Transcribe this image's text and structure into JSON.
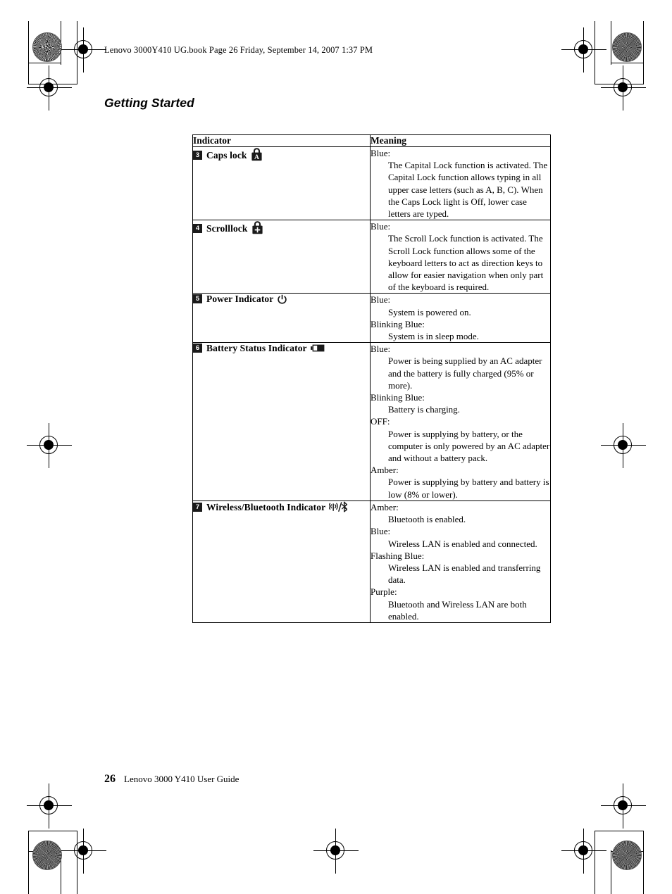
{
  "document": {
    "header_line": "Lenovo 3000Y410 UG.book  Page 26  Friday, September 14, 2007  1:37 PM",
    "page_title": "Getting Started",
    "footer": {
      "page_number": "26",
      "guide_title": "Lenovo 3000 Y410 User Guide"
    }
  },
  "table": {
    "headers": {
      "indicator": "Indicator",
      "meaning": "Meaning"
    },
    "rows": [
      {
        "number": "3",
        "label": "Caps lock",
        "icon": "caps-lock-padlock-icon",
        "meaning": [
          {
            "term": "Blue:",
            "desc": "The Capital Lock function is activated. The Capital Lock function allows typing in all upper case letters (such as A, B, C). When the Caps Lock light is Off, lower case letters are typed."
          }
        ]
      },
      {
        "number": "4",
        "label": "Scrolllock",
        "icon": "scroll-lock-padlock-icon",
        "meaning": [
          {
            "term": "Blue:",
            "desc": "The Scroll Lock function is activated. The Scroll Lock function allows some of the keyboard letters to act as direction keys to allow for easier navigation when only part of the keyboard is required."
          }
        ]
      },
      {
        "number": "5",
        "label": "Power Indicator",
        "icon": "power-icon",
        "meaning": [
          {
            "term": "Blue:",
            "desc": "System is powered on."
          },
          {
            "term": "Blinking Blue:",
            "desc": "System is in sleep mode."
          }
        ]
      },
      {
        "number": "6",
        "label": "Battery Status Indicator",
        "icon": "battery-icon",
        "meaning": [
          {
            "term": "Blue:",
            "desc": "Power is being supplied by an AC adapter and the battery is fully charged (95% or more)."
          },
          {
            "term": "Blinking Blue:",
            "desc": "Battery is charging."
          },
          {
            "term": "OFF:",
            "desc": "Power is supplying by battery, or the computer is only powered by an AC adapter and without a battery pack."
          },
          {
            "term": "Amber:",
            "desc": "Power is supplying by battery and battery is low (8% or lower)."
          }
        ]
      },
      {
        "number": "7",
        "label": "Wireless/Bluetooth Indicator",
        "icon": "wireless-bluetooth-icon",
        "meaning": [
          {
            "term": "Amber:",
            "desc": "Bluetooth is enabled."
          },
          {
            "term": "Blue:",
            "desc": "Wireless LAN is enabled and connected."
          },
          {
            "term": "Flashing Blue:",
            "desc": "Wireless LAN is enabled and transferring data."
          },
          {
            "term": "Purple:",
            "desc": "Bluetooth and Wireless LAN are both enabled."
          }
        ]
      }
    ]
  }
}
